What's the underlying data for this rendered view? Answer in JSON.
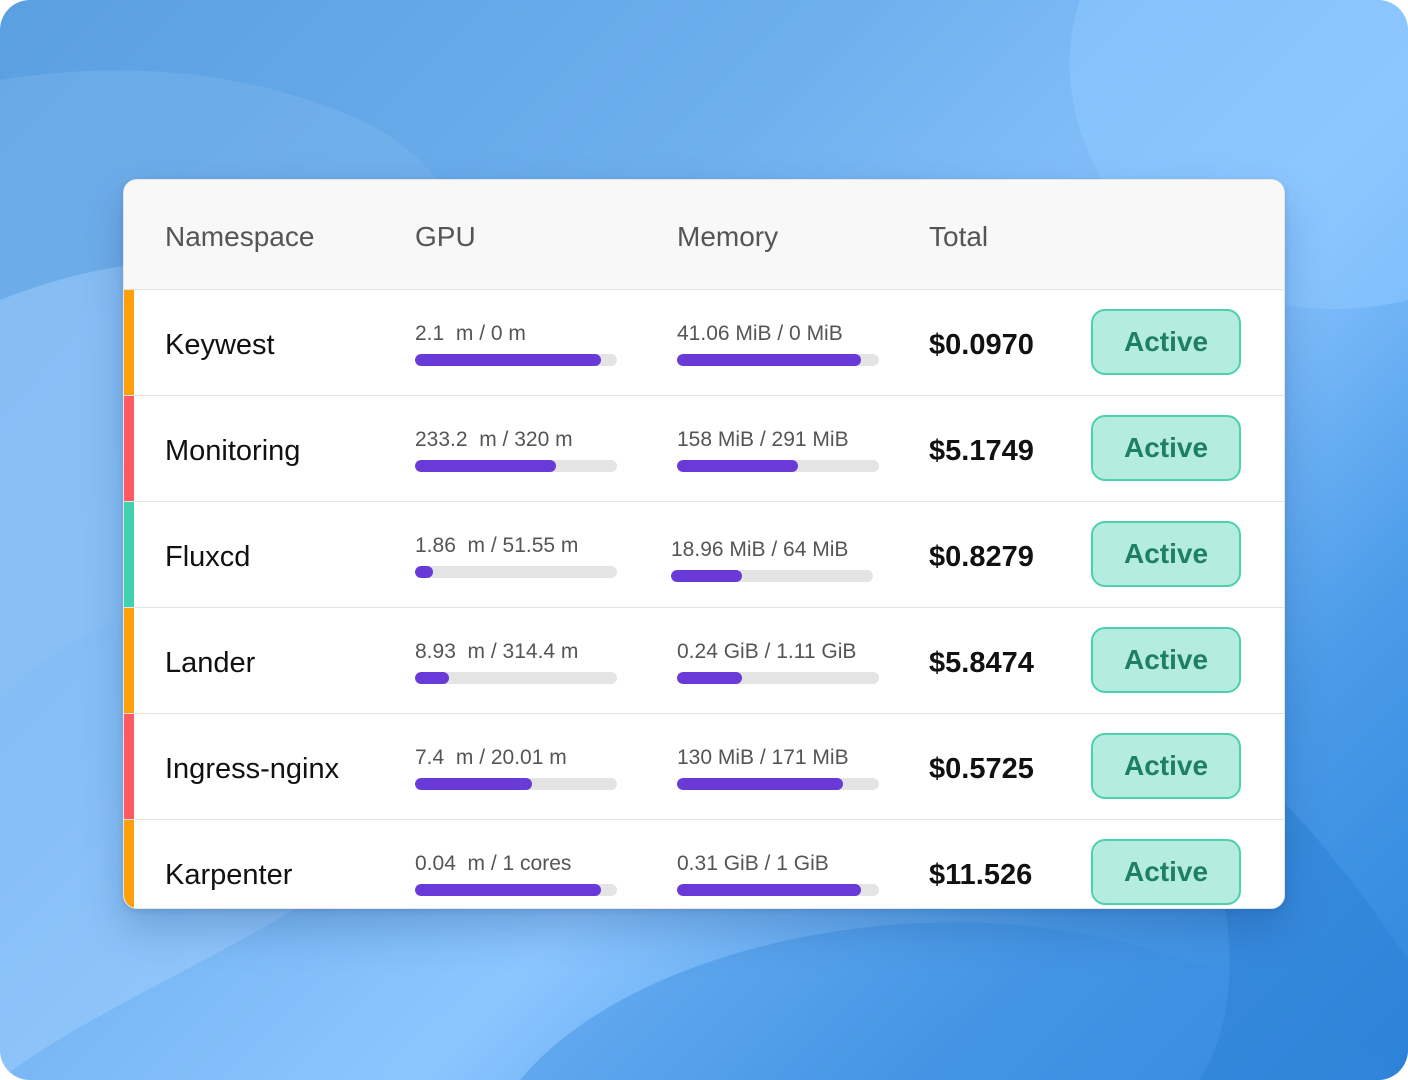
{
  "table": {
    "headers": {
      "namespace": "Namespace",
      "gpu": "GPU",
      "memory": "Memory",
      "total": "Total"
    },
    "rows": [
      {
        "namespace": "Keywest",
        "stripe_color": "#ff9f0a",
        "gpu_label": "2.1  m / 0 m",
        "gpu_fill": 0.92,
        "memory_label": "41.06 MiB / 0 MiB",
        "memory_fill": 0.91,
        "total": "$0.0970",
        "status": "Active"
      },
      {
        "namespace": "Monitoring",
        "stripe_color": "#ff5a64",
        "gpu_label": "233.2  m / 320 m",
        "gpu_fill": 0.7,
        "memory_label": "158 MiB / 291 MiB",
        "memory_fill": 0.6,
        "total": "$5.1749",
        "status": "Active"
      },
      {
        "namespace": "Fluxcd",
        "stripe_color": "#40d2b0",
        "gpu_label": "1.86  m / 51.55 m",
        "gpu_fill": 0.09,
        "memory_label": "18.96 MiB / 64 MiB",
        "memory_fill": 0.35,
        "total": "$0.8279",
        "status": "Active"
      },
      {
        "namespace": "Lander",
        "stripe_color": "#ff9f0a",
        "gpu_label": "8.93  m / 314.4 m",
        "gpu_fill": 0.17,
        "memory_label": "0.24 GiB / 1.11 GiB",
        "memory_fill": 0.32,
        "total": "$5.8474",
        "status": "Active"
      },
      {
        "namespace": "Ingress-nginx",
        "stripe_color": "#ff5a64",
        "gpu_label": "7.4  m / 20.01 m",
        "gpu_fill": 0.58,
        "memory_label": "130 MiB / 171 MiB",
        "memory_fill": 0.82,
        "total": "$0.5725",
        "status": "Active"
      },
      {
        "namespace": "Karpenter",
        "stripe_color": "#ff9f0a",
        "gpu_label": "0.04  m / 1 cores",
        "gpu_fill": 0.92,
        "memory_label": "0.31 GiB / 1 GiB",
        "memory_fill": 0.91,
        "total": "$11.526",
        "status": "Active"
      }
    ]
  }
}
